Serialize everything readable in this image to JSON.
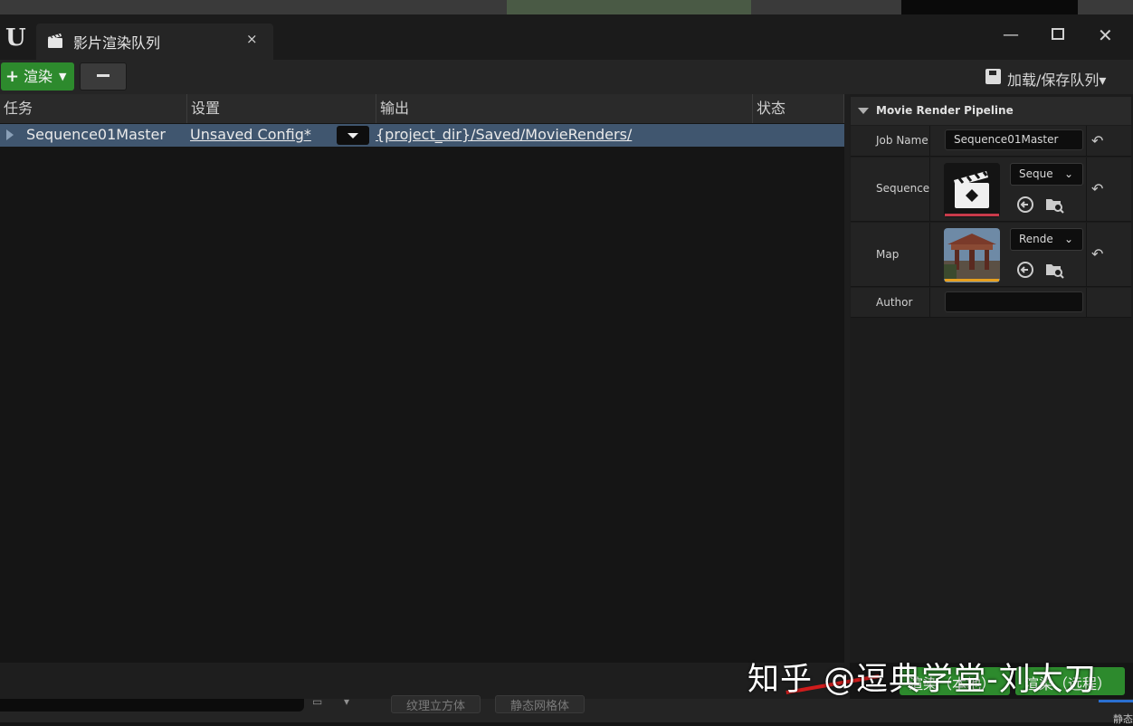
{
  "window": {
    "tab_title": "影片渲染队列",
    "close_glyph": "×",
    "minimize_glyph": "—",
    "win_close_glyph": "✕",
    "logo_glyph": "U"
  },
  "toolbar": {
    "render_label": "渲染",
    "render_plus": "+",
    "render_caret": "▼",
    "save_load_label": "加载/保存队列▾"
  },
  "table": {
    "columns": [
      "任务",
      "设置",
      "输出",
      "状态"
    ],
    "rows": [
      {
        "job": "Sequence01Master",
        "settings": "Unsaved Config*",
        "output": "{project_dir}/Saved/MovieRenders/",
        "status": ""
      }
    ]
  },
  "panel": {
    "title": "Movie Render Pipeline",
    "reset_glyph": "↶",
    "job_name_label": "Job Name",
    "job_name_value": "Sequence01Master",
    "sequence_label": "Sequence",
    "sequence_combo": "Seque",
    "map_label": "Map",
    "map_combo": "Rende",
    "author_label": "Author",
    "author_value": "",
    "chevron": "⌄"
  },
  "bottom": {
    "render_local_partial": "渲染（本地）",
    "render_remote_partial": "渲染（远程）",
    "strip_btn_1": "纹理立方体",
    "strip_btn_2": "静态网格体",
    "status_partial": "静态"
  },
  "watermark": "知乎 @逗典学堂-刘大刀",
  "colors": {
    "accent_green": "#2d8a2d",
    "selected_row": "#40566f",
    "background": "#151515"
  }
}
